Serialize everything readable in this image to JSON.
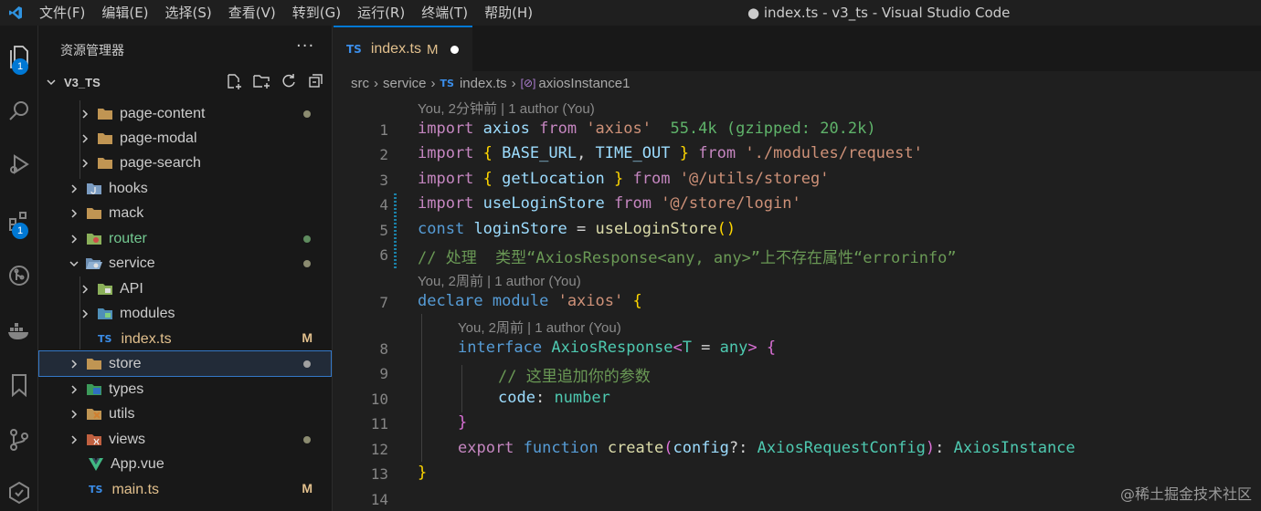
{
  "menubar": {
    "items": [
      "文件(F)",
      "编辑(E)",
      "选择(S)",
      "查看(V)",
      "转到(G)",
      "运行(R)",
      "终端(T)",
      "帮助(H)"
    ],
    "window_title": "● index.ts - v3_ts - Visual Studio Code"
  },
  "activitybar": {
    "explorer_badge": "1",
    "extensions_badge": "1"
  },
  "sidebar": {
    "header": "资源管理器",
    "more": "···",
    "root_label": "V3_TS",
    "items": [
      {
        "label": "page-content",
        "status": "dot"
      },
      {
        "label": "page-modal"
      },
      {
        "label": "page-search"
      },
      {
        "label": "hooks"
      },
      {
        "label": "mack"
      },
      {
        "label": "router",
        "status": "dot"
      },
      {
        "label": "service",
        "status": "dot"
      },
      {
        "label": "API"
      },
      {
        "label": "modules"
      },
      {
        "label": "index.ts",
        "status": "M"
      },
      {
        "label": "store",
        "status": "dot"
      },
      {
        "label": "types"
      },
      {
        "label": "utils"
      },
      {
        "label": "views",
        "status": "dot"
      },
      {
        "label": "App.vue"
      },
      {
        "label": "main.ts",
        "status": "M"
      }
    ]
  },
  "tab": {
    "icon": "TS",
    "name": "index.ts",
    "status": "M"
  },
  "breadcrumb": {
    "parts": [
      "src",
      "service",
      "index.ts",
      "axiosInstance1"
    ],
    "ts_icon": "TS"
  },
  "editor": {
    "codelens": [
      "You, 2分钟前 | 1 author (You)",
      "You, 2周前 | 1 author (You)",
      "You, 2周前 | 1 author (You)"
    ],
    "line_numbers": [
      "1",
      "2",
      "3",
      "4",
      "5",
      "6",
      "7",
      "8",
      "9",
      "10",
      "11",
      "12",
      "13",
      "14"
    ],
    "import_cost": "55.4k (gzipped: 20.2k)",
    "comment_line6": "// 处理  类型“AxiosResponse<any, any>”上不存在属性“errorinfo”",
    "comment_line9": "// 这里追加你的参数"
  },
  "watermark": "@稀土掘金技术社区"
}
